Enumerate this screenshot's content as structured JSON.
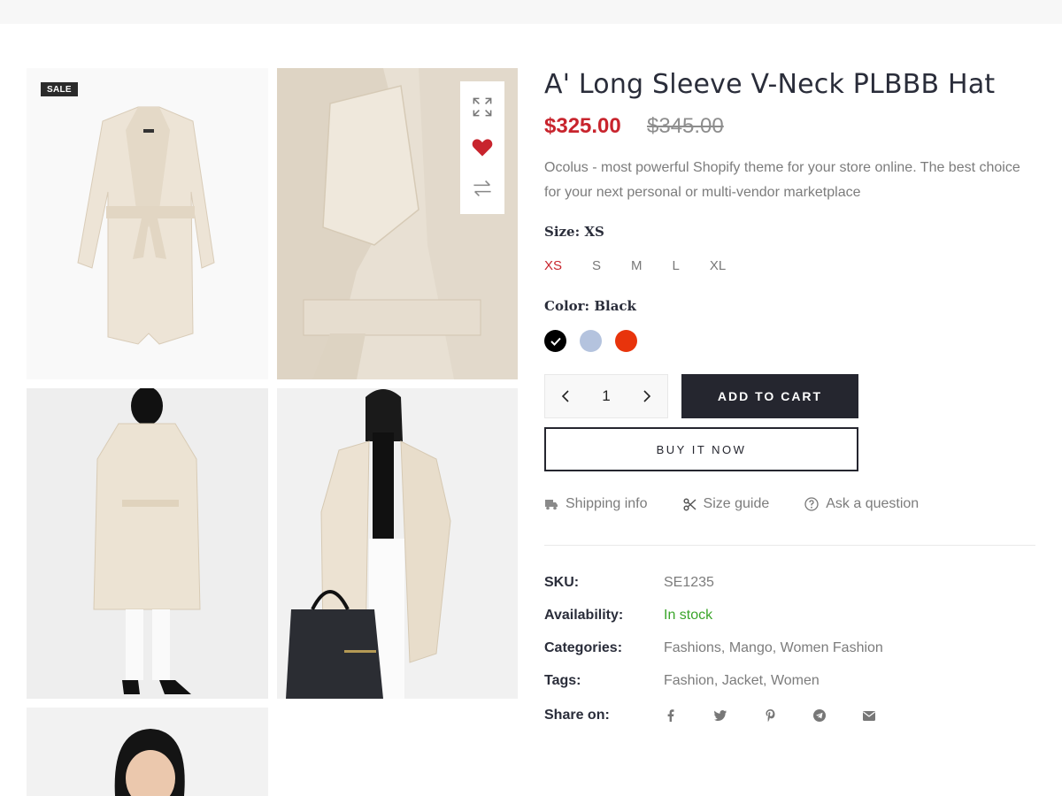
{
  "product": {
    "title": "A' Long Sleeve V-Neck PLBBB Hat",
    "price": "$325.00",
    "compare_price": "$345.00",
    "description": "Ocolus - most powerful Shopify theme for your store online. The best choice for your next personal or multi-vendor marketplace",
    "badge": "SALE"
  },
  "size": {
    "label": "Size:",
    "selected": "XS",
    "options": [
      "XS",
      "S",
      "M",
      "L",
      "XL"
    ]
  },
  "color": {
    "label": "Color:",
    "selected": "Black",
    "swatches": [
      "#000000",
      "#b4c3de",
      "#e8340c"
    ]
  },
  "quantity": {
    "value": "1"
  },
  "buttons": {
    "add_to_cart": "ADD TO CART",
    "buy_now": "BUY IT NOW"
  },
  "links": {
    "shipping": "Shipping info",
    "size_guide": "Size guide",
    "ask": "Ask a question"
  },
  "meta": {
    "sku_label": "SKU:",
    "sku": "SE1235",
    "availability_label": "Availability:",
    "availability": "In stock",
    "categories_label": "Categories:",
    "categories": "Fashions, Mango, Women Fashion",
    "tags_label": "Tags:",
    "tags": "Fashion, Jacket, Women",
    "share_label": "Share on:"
  },
  "share_icons": [
    "facebook-icon",
    "twitter-icon",
    "pinterest-icon",
    "telegram-icon",
    "email-icon"
  ],
  "colors": {
    "price": "#c8242d",
    "dark": "#25262f",
    "in_stock": "#3aa52a",
    "wishlist": "#c8242d"
  }
}
